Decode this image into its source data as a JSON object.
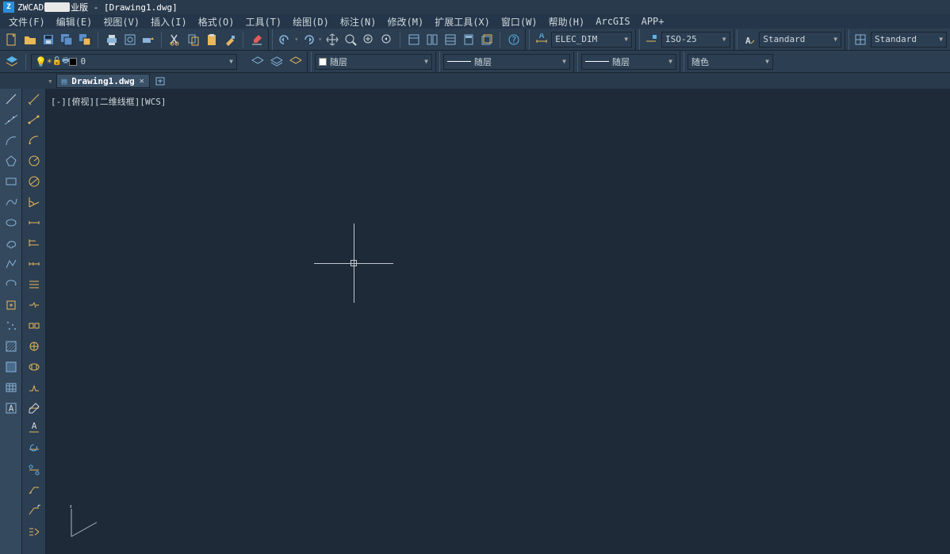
{
  "title": {
    "app": "ZWCAD",
    "edition": "业版",
    "file": "[Drawing1.dwg]"
  },
  "menu": {
    "file": "文件(F)",
    "edit": "编辑(E)",
    "view": "视图(V)",
    "insert": "插入(I)",
    "format": "格式(O)",
    "tools": "工具(T)",
    "draw": "绘图(D)",
    "dimension": "标注(N)",
    "modify": "修改(M)",
    "extend": "扩展工具(X)",
    "window": "窗口(W)",
    "help": "帮助(H)",
    "arcgis": "ArcGIS",
    "appplus": "APP+"
  },
  "combos": {
    "dimstyle": "ELEC_DIM",
    "iso": "ISO-25",
    "textstyle1": "Standard",
    "textstyle2": "Standard",
    "layer_num": "0",
    "bylayer1": "随层",
    "bylayer2": "随层",
    "bylayer3": "随层",
    "bycolor": "随色"
  },
  "tab": {
    "name": "Drawing1.dwg"
  },
  "canvas": {
    "status": "[-][俯视][二维线框][WCS]"
  }
}
